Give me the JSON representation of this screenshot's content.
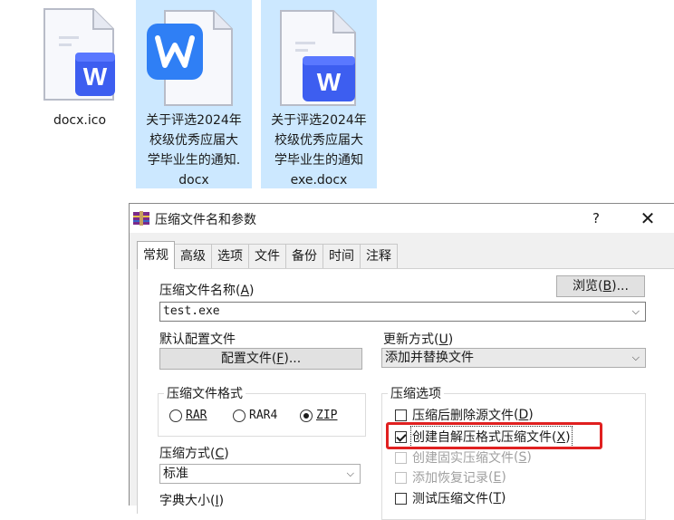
{
  "desktop": {
    "files": [
      {
        "name_lines": [
          "docx.ico"
        ],
        "icon": "word-doc-icon",
        "selected": false
      },
      {
        "name_lines": [
          "关于评选2024年",
          "校级优秀应届大",
          "学毕业生的通知.",
          "docx"
        ],
        "icon": "wps-writer-icon",
        "selected": true
      },
      {
        "name_lines": [
          "关于评选2024年",
          "校级优秀应届大",
          "学毕业生的通知",
          "exe.docx"
        ],
        "icon": "word-doc-icon",
        "selected": true
      }
    ]
  },
  "dialog": {
    "title": "压缩文件名和参数",
    "help": "?",
    "close": "✕",
    "tabs": [
      "常规",
      "高级",
      "选项",
      "文件",
      "备份",
      "时间",
      "注释"
    ],
    "archive_name_label": "压缩文件名称",
    "archive_name_key": "A",
    "browse_label": "浏览",
    "browse_key": "B",
    "archive_name_value": "test.exe",
    "default_profile_label": "默认配置文件",
    "profile_button": "配置文件",
    "profile_key": "F",
    "update_mode_label": "更新方式",
    "update_mode_key": "U",
    "update_mode_value": "添加并替换文件",
    "format_group_title": "压缩文件格式",
    "formats": [
      {
        "label": "RAR",
        "key": "R",
        "selected": false
      },
      {
        "label": "RAR4",
        "key": "4",
        "selected": false
      },
      {
        "label": "ZIP",
        "key": "Z",
        "selected": true
      }
    ],
    "method_label": "压缩方式",
    "method_key": "C",
    "method_value": "标准",
    "dict_label": "字典大小",
    "dict_key": "I",
    "options_group_title": "压缩选项",
    "options": [
      {
        "label": "压缩后删除源文件",
        "key": "D",
        "checked": false,
        "disabled": false
      },
      {
        "label": "创建自解压格式压缩文件",
        "key": "X",
        "checked": true,
        "disabled": false
      },
      {
        "label": "创建固实压缩文件",
        "key": "S",
        "checked": false,
        "disabled": true
      },
      {
        "label": "添加恢复记录",
        "key": "E",
        "checked": false,
        "disabled": true
      },
      {
        "label": "测试压缩文件",
        "key": "T",
        "checked": false,
        "disabled": false
      }
    ],
    "highlight_color": "#e02020"
  }
}
